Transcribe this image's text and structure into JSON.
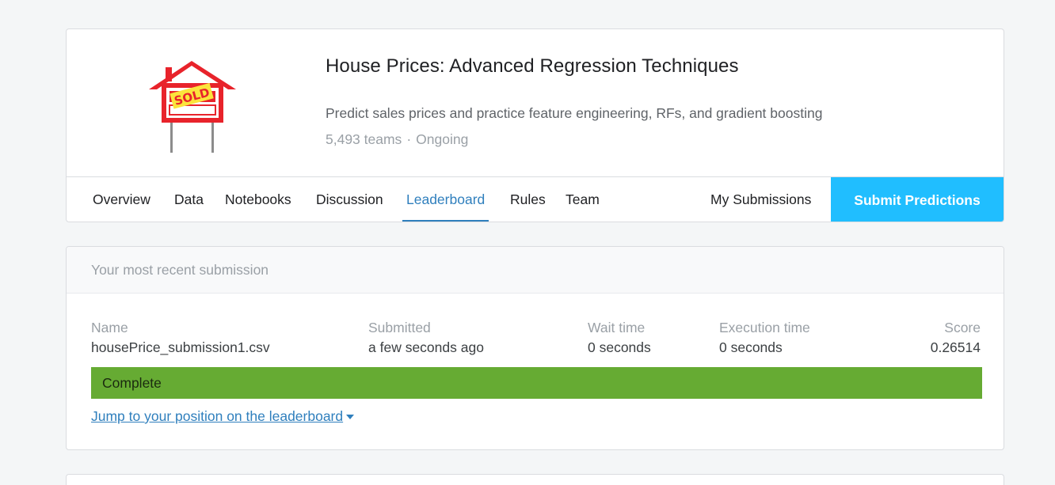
{
  "competition": {
    "title": "House Prices: Advanced Regression Techniques",
    "description": "Predict sales prices and practice feature engineering, RFs, and gradient boosting",
    "teams": "5,493 teams",
    "meta_separator": "·",
    "status": "Ongoing",
    "logo": {
      "icon": "sold-house-sign-icon",
      "text": "SOLD",
      "house_color": "#e8232b",
      "banner_color": "#fbe43c"
    }
  },
  "tabs": {
    "overview": "Overview",
    "data": "Data",
    "notebooks": "Notebooks",
    "discussion": "Discussion",
    "leaderboard": "Leaderboard",
    "rules": "Rules",
    "team": "Team",
    "active": "Leaderboard"
  },
  "actions": {
    "my_submissions": "My Submissions",
    "submit_predictions": "Submit Predictions"
  },
  "submission": {
    "heading": "Your most recent submission",
    "columns": {
      "name": "Name",
      "submitted": "Submitted",
      "wait_time": "Wait time",
      "execution_time": "Execution time",
      "score": "Score"
    },
    "values": {
      "name": "housePrice_submission1.csv",
      "submitted": "a few seconds ago",
      "wait_time": "0 seconds",
      "execution_time": "0 seconds",
      "score": "0.26514"
    },
    "status": "Complete",
    "status_color": "#66ab33",
    "jump_link": "Jump to your position on the leaderboard"
  },
  "colors": {
    "accent": "#2f7fbd",
    "submit_button": "#20beff"
  }
}
